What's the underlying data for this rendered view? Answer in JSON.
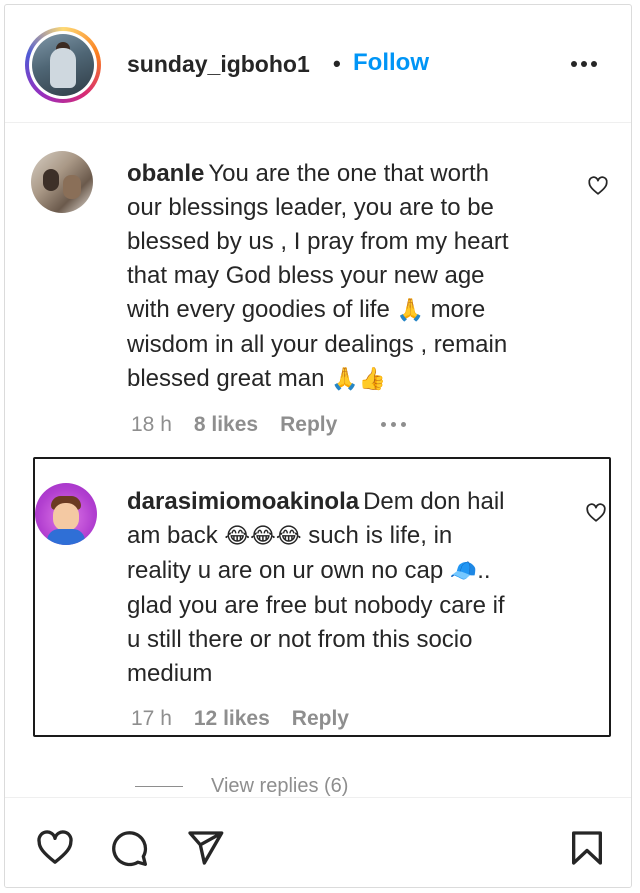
{
  "header": {
    "username": "sunday_igboho1",
    "separator": "•",
    "follow_label": "Follow",
    "more_icon": "more-horizontal-icon"
  },
  "comments": [
    {
      "username": "obanle",
      "text_segments": [
        "You are the one that worth",
        "our blessings leader, you are to be",
        "blessed by us , I pray from my heart",
        "that may God bless your new age",
        "with every goodies of life",
        "more",
        "wisdom in all your dealings , remain",
        "blessed great man"
      ],
      "emojis": [
        "🙏",
        "🙏",
        "👍"
      ],
      "time": "18 h",
      "likes": "8 likes",
      "reply_label": "Reply",
      "like_icon": "heart-outline-icon"
    },
    {
      "username": "darasimiomoakinola",
      "text_segments": [
        "Dem don hail",
        "am back",
        "such is life, in",
        "reality u are on ur own no cap",
        "..",
        "glad you are free but nobody care if",
        "u still there or not from this socio",
        "medium"
      ],
      "emojis": [
        "😂",
        "😂",
        "😂",
        "🧢"
      ],
      "time": "17 h",
      "likes": "12 likes",
      "reply_label": "Reply",
      "like_icon": "heart-outline-icon"
    }
  ],
  "view_replies": "View replies (6)",
  "actions": {
    "like_icon": "heart-icon",
    "comment_icon": "comment-icon",
    "share_icon": "send-icon",
    "save_icon": "bookmark-icon"
  },
  "colors": {
    "accent": "#0095f6",
    "text": "#262626",
    "muted": "#8e8e8e"
  }
}
